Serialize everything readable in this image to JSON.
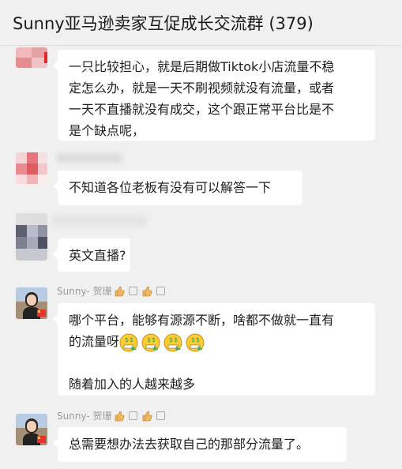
{
  "header": {
    "title": "Sunny亚马逊卖家互促成长交流群 (379)"
  },
  "colors": {
    "background": "#f0f0f0",
    "bubble": "#ffffff",
    "text": "#1e1e1e",
    "sender": "#9a9a9a"
  },
  "messages": [
    {
      "lines": [
        "一只比较担心，就是后期做Tiktok小店流量不稳",
        "定怎么办，就是一天不刷视频就没有流量，或者",
        "一天不直播就没有成交，这个跟正常平台比是不",
        "是个缺点呢，"
      ]
    },
    {
      "lines": [
        "不知道各位老板有没有可以解答一下"
      ]
    },
    {
      "lines": [
        "英文直播?"
      ]
    },
    {
      "sender": "Sunny- 贺珊",
      "lines": [
        "哪个平台，能够有源源不断，啥都不做就一直有",
        "的流量呀"
      ],
      "extra": "随着加入的人越来越多",
      "emoji": "money-face-emoji"
    },
    {
      "sender": "Sunny- 贺珊",
      "lines": [
        "总需要想办法去获取自己的那部分流量了。"
      ]
    }
  ]
}
